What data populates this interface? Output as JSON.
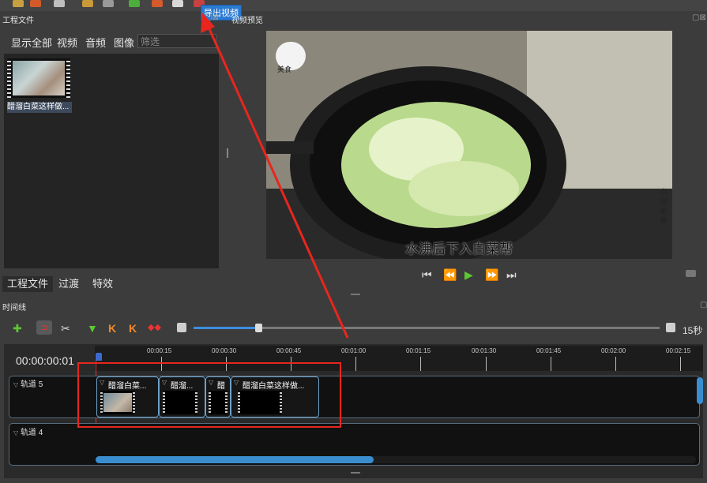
{
  "toolbar": {
    "tooltip": "导出视频"
  },
  "project_files": {
    "title": "工程文件",
    "filters": [
      "显示全部",
      "视频",
      "音频",
      "图像"
    ],
    "filter_placeholder": "筛选",
    "items": [
      {
        "label": "醋溜白菜这样做..."
      }
    ]
  },
  "preview": {
    "title": "视频预览",
    "overlay_brand": "美食",
    "overlay_vertical": "小房美食",
    "subtitle": "水沸后下入白菜帮"
  },
  "left_tabs": [
    "工程文件",
    "过渡",
    "特效"
  ],
  "timeline": {
    "title": "时间线",
    "timecode": "00:00:00:01",
    "zoom_label": "15秒",
    "zoom_fraction": 0.14,
    "ruler_labels": [
      "00:00:15",
      "00:00:30",
      "00:00:45",
      "00:01:00",
      "00:01:15",
      "00:01:30",
      "00:01:45",
      "00:02:00",
      "00:02:15"
    ],
    "tracks": [
      {
        "name": "轨道 5",
        "clips": [
          {
            "title": "醋溜白菜..."
          },
          {
            "title": "醋溜..."
          },
          {
            "title": "醋"
          },
          {
            "title": "醋溜白菜这样做..."
          }
        ]
      },
      {
        "name": "轨道 4",
        "clips": []
      }
    ]
  },
  "colors": {
    "accent": "#3d8ee0",
    "annotation_red": "#e8261e"
  }
}
